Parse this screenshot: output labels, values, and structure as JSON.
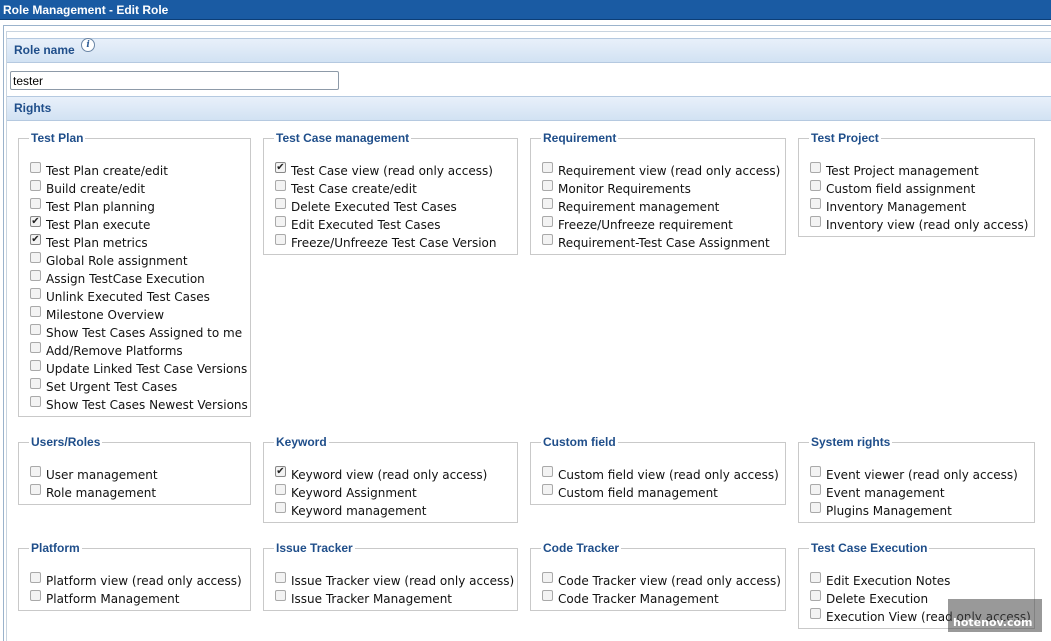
{
  "window": {
    "title": "Role Management - Edit Role"
  },
  "role_name": {
    "label": "Role name",
    "value": "tester"
  },
  "rights": {
    "label": "Rights"
  },
  "groups": [
    {
      "title": "Test Plan",
      "items": [
        {
          "label": "Test Plan create/edit",
          "checked": false
        },
        {
          "label": "Build create/edit",
          "checked": false
        },
        {
          "label": "Test Plan planning",
          "checked": false
        },
        {
          "label": "Test Plan execute",
          "checked": true
        },
        {
          "label": "Test Plan metrics",
          "checked": true
        },
        {
          "label": "Global Role assignment",
          "checked": false
        },
        {
          "label": "Assign TestCase Execution",
          "checked": false
        },
        {
          "label": "Unlink Executed Test Cases",
          "checked": false
        },
        {
          "label": "Milestone Overview",
          "checked": false
        },
        {
          "label": "Show Test Cases Assigned to me",
          "checked": false
        },
        {
          "label": "Add/Remove Platforms",
          "checked": false
        },
        {
          "label": "Update Linked Test Case Versions",
          "checked": false
        },
        {
          "label": "Set Urgent Test Cases",
          "checked": false
        },
        {
          "label": "Show Test Cases Newest Versions",
          "checked": false
        }
      ]
    },
    {
      "title": "Test Case management",
      "items": [
        {
          "label": "Test Case view (read only access)",
          "checked": true
        },
        {
          "label": "Test Case create/edit",
          "checked": false
        },
        {
          "label": "Delete Executed Test Cases",
          "checked": false
        },
        {
          "label": "Edit Executed Test Cases",
          "checked": false
        },
        {
          "label": "Freeze/Unfreeze Test Case Version",
          "checked": false
        }
      ]
    },
    {
      "title": "Requirement",
      "items": [
        {
          "label": "Requirement view (read only access)",
          "checked": false
        },
        {
          "label": "Monitor Requirements",
          "checked": false
        },
        {
          "label": "Requirement management",
          "checked": false
        },
        {
          "label": "Freeze/Unfreeze requirement",
          "checked": false
        },
        {
          "label": "Requirement-Test Case Assignment",
          "checked": false
        }
      ]
    },
    {
      "title": "Test Project",
      "items": [
        {
          "label": "Test Project management",
          "checked": false
        },
        {
          "label": "Custom field assignment",
          "checked": false
        },
        {
          "label": "Inventory Management",
          "checked": false
        },
        {
          "label": "Inventory view (read only access)",
          "checked": false
        }
      ]
    },
    {
      "title": "Users/Roles",
      "items": [
        {
          "label": "User management",
          "checked": false
        },
        {
          "label": "Role management",
          "checked": false
        }
      ]
    },
    {
      "title": "Keyword",
      "items": [
        {
          "label": "Keyword view (read only access)",
          "checked": true
        },
        {
          "label": "Keyword Assignment",
          "checked": false
        },
        {
          "label": "Keyword management",
          "checked": false
        }
      ]
    },
    {
      "title": "Custom field",
      "items": [
        {
          "label": "Custom field view (read only access)",
          "checked": false
        },
        {
          "label": "Custom field management",
          "checked": false
        }
      ]
    },
    {
      "title": "System rights",
      "items": [
        {
          "label": "Event viewer (read only access)",
          "checked": false
        },
        {
          "label": "Event management",
          "checked": false
        },
        {
          "label": "Plugins Management",
          "checked": false
        }
      ]
    },
    {
      "title": "Platform",
      "items": [
        {
          "label": "Platform view (read only access)",
          "checked": false
        },
        {
          "label": "Platform Management",
          "checked": false
        }
      ]
    },
    {
      "title": "Issue Tracker",
      "items": [
        {
          "label": "Issue Tracker view (read only access)",
          "checked": false
        },
        {
          "label": "Issue Tracker Management",
          "checked": false
        }
      ]
    },
    {
      "title": "Code Tracker",
      "items": [
        {
          "label": "Code Tracker view (read only access)",
          "checked": false
        },
        {
          "label": "Code Tracker Management",
          "checked": false
        }
      ]
    },
    {
      "title": "Test Case Execution",
      "items": [
        {
          "label": "Edit Execution Notes",
          "checked": false
        },
        {
          "label": "Delete Execution",
          "checked": false
        },
        {
          "label": "Execution View (read only access)",
          "checked": false
        }
      ]
    }
  ],
  "watermark": {
    "text": "hotenov.com"
  },
  "icons": {
    "info": "info-icon",
    "check": "checkmark-icon"
  }
}
